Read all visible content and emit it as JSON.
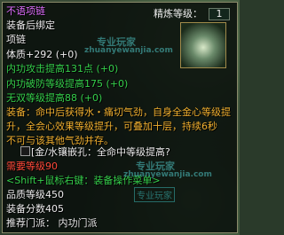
{
  "tooltip": {
    "title": "不语项链",
    "bind_status": "装备后绑定",
    "item_type": "项链",
    "refine_level_label": "精炼等级：",
    "refine_level_value": "1",
    "stat_constitution": "体质+292 (+0)",
    "stat_internal_attack": "内功攻击提高131点 (+0)",
    "stat_internal_pierce": "内功破防等级提高175 (+0)",
    "stat_no_parry": "无双等级提高88 (+0)",
    "set_effect_1": "装备：命中后获得水・痛切气劲，自身全金心等级提",
    "set_effect_2": "升，全会心效果等级提升，可叠加十层，持续6秒",
    "set_effect_3": "不可与该其他气劲并存。",
    "gem_socket": "[金/水镶嵌孔：全命中等级提高?",
    "required_level": "需要等级90",
    "shift_hint": "<Shift+鼠标右键：装备操作菜单>",
    "quality_level": "品质等级450",
    "equip_score": "装备分数405",
    "recommend_sect": "推荐门派：   内功门派"
  },
  "watermark": {
    "site_text_cn": "专业玩家",
    "site_url": "zhuanyewanjia.com",
    "seal_text": "专业玩家"
  },
  "colors": {
    "title": "#e070ff",
    "stat": "#36d04c",
    "effect": "#f0b030",
    "required": "#ff4a3a",
    "hint": "#36d04c"
  }
}
